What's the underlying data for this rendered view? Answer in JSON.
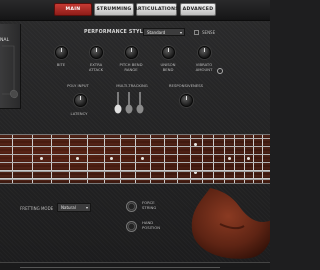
{
  "tabs": [
    {
      "label": "MAIN",
      "active": true
    },
    {
      "label": "STRUMMING",
      "active": false
    },
    {
      "label": "ARTICULATIONS",
      "active": false
    },
    {
      "label": "ADVANCED",
      "active": false
    }
  ],
  "left_panel": {
    "label": "NAL"
  },
  "performance": {
    "label": "PERFORMANCE STYLE",
    "value": "Standard",
    "sense_label": "SENSE"
  },
  "knobs_row1": [
    {
      "label": "BITE"
    },
    {
      "label": "EXTRA\nATTACK"
    },
    {
      "label": "PITCH BEND\nRANGE"
    },
    {
      "label": "UNISON\nBEND"
    },
    {
      "label": "VIBRATO\nAMOUNT"
    }
  ],
  "poly_input": {
    "label": "POLY INPUT"
  },
  "latency": {
    "label": "LATENCY"
  },
  "multi_tracking": {
    "label": "MULTI-TRACKING"
  },
  "responsiveness": {
    "label": "RESPONSIVENESS"
  },
  "fretting_mode": {
    "label": "FRETTING MODE",
    "value": "Natural"
  },
  "force_string": {
    "label": "FORCE\nSTRING"
  },
  "hand_position": {
    "label": "HAND\nPOSITION"
  },
  "colors": {
    "accent": "#c0362f",
    "fretboard": "#4a2116"
  }
}
